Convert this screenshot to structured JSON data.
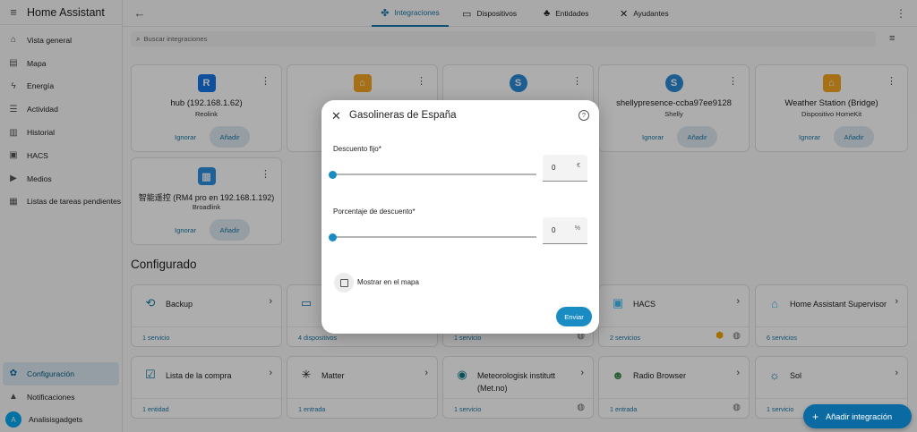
{
  "app": {
    "title": "Home Assistant"
  },
  "sidebar": {
    "items": [
      {
        "label": "Vista general",
        "icon": "home-icon",
        "glyph": "⌂"
      },
      {
        "label": "Mapa",
        "icon": "map-icon",
        "glyph": "▤"
      },
      {
        "label": "Energía",
        "icon": "lightning-icon",
        "glyph": "ϟ"
      },
      {
        "label": "Actividad",
        "icon": "list-icon",
        "glyph": "☰"
      },
      {
        "label": "Historial",
        "icon": "chart-icon",
        "glyph": "▥"
      },
      {
        "label": "HACS",
        "icon": "hacs-icon",
        "glyph": "▣"
      },
      {
        "label": "Medios",
        "icon": "media-icon",
        "glyph": "▶"
      },
      {
        "label": "Listas de tareas pendientes",
        "icon": "clipboard-icon",
        "glyph": "▦"
      }
    ],
    "config": "Configuración",
    "notifications": "Notificaciones",
    "user": {
      "name": "Analisisgadgets",
      "initial": "A"
    }
  },
  "topbar": {
    "tabs": [
      {
        "label": "Integraciones",
        "glyph": "✤"
      },
      {
        "label": "Dispositivos",
        "glyph": "▭"
      },
      {
        "label": "Entidades",
        "glyph": "♣"
      },
      {
        "label": "Ayudantes",
        "glyph": "✕"
      }
    ]
  },
  "search": {
    "placeholder": "Buscar integraciones"
  },
  "discovered": [
    {
      "name": "hub (192.168.1.62)",
      "sub": "Reolink",
      "logo": "reolink-logo-icon",
      "glyph": "R",
      "color": "#1677e8"
    },
    {
      "name": "",
      "sub": "",
      "logo": "homekit-logo-icon",
      "glyph": "⌂",
      "color": "#f5a623"
    },
    {
      "name": "",
      "sub": "",
      "logo": "shelly-logo-icon",
      "glyph": "S",
      "color": "#2a8bd6"
    },
    {
      "name": "shellypresence-ccba97ee9128",
      "sub": "Shelly",
      "logo": "shelly-logo-icon",
      "glyph": "S",
      "color": "#2a8bd6"
    },
    {
      "name": "Weather Station (Bridge)",
      "sub": "Dispositivo HomeKit",
      "logo": "homekit-logo-icon",
      "glyph": "⌂",
      "color": "#f5a623"
    },
    {
      "name": "智能遥控 (RM4 pro en 192.168.1.192)",
      "sub": "Broadlink",
      "logo": "broadlink-logo-icon",
      "glyph": "▥",
      "color": "#2d8fe0"
    }
  ],
  "discovered_actions": {
    "ignore": "Ignorar",
    "add": "Añadir"
  },
  "configured": {
    "title": "Configurado",
    "items": [
      {
        "name": "Backup",
        "count": "1 servicio",
        "icon": "backup-icon",
        "glyph": "⟲",
        "color": "#1a78a8"
      },
      {
        "name": "",
        "count": "4 dispositivos",
        "icon": "cast-icon",
        "glyph": "▭",
        "color": "#1a78a8"
      },
      {
        "name": "",
        "count": "1 servicio",
        "icon": "globe-icon",
        "glyph": "",
        "color": "#1a78a8"
      },
      {
        "name": "HACS",
        "count": "2 servicios",
        "icon": "hacs-logo-icon",
        "glyph": "▣",
        "color": "#41bdf5"
      },
      {
        "name": "Home Assistant Supervisor",
        "count": "6 servicios",
        "icon": "supervisor-icon",
        "glyph": "⌂",
        "color": "#41bdf5"
      },
      {
        "name": "Lista de la compra",
        "count": "1 entidad",
        "icon": "checklist-icon",
        "glyph": "☑",
        "color": "#1a78a8"
      },
      {
        "name": "Matter",
        "count": "1 entrada",
        "icon": "matter-logo-icon",
        "glyph": "✳",
        "color": "#222222"
      },
      {
        "name": "Meteorologisk institutt (Met.no)",
        "count": "1 servicio",
        "icon": "met-logo-icon",
        "glyph": "◉",
        "color": "#0b7a8a"
      },
      {
        "name": "Radio Browser",
        "count": "1 entrada",
        "icon": "radio-browser-icon",
        "glyph": "☻",
        "color": "#3b8d4a"
      },
      {
        "name": "Sol",
        "count": "1 servicio",
        "icon": "sun-icon",
        "glyph": "☼",
        "color": "#1a78a8"
      }
    ]
  },
  "dialog": {
    "title": "Gasolineras de España",
    "fixed_label": "Descuento fijo*",
    "fixed_value": "0",
    "fixed_unit": "€",
    "fixed_slider": 0,
    "percent_label": "Porcentaje de descuento*",
    "percent_value": "0",
    "percent_unit": "%",
    "percent_slider": 0,
    "checkbox_label": "Mostrar en el mapa",
    "checkbox_checked": false,
    "submit": "Enviar"
  },
  "fab": {
    "label": "Añadir integración"
  },
  "colors": {
    "accent": "#1a78a8",
    "primary": "#0b6aa1",
    "slider": "#1a8cc4"
  }
}
